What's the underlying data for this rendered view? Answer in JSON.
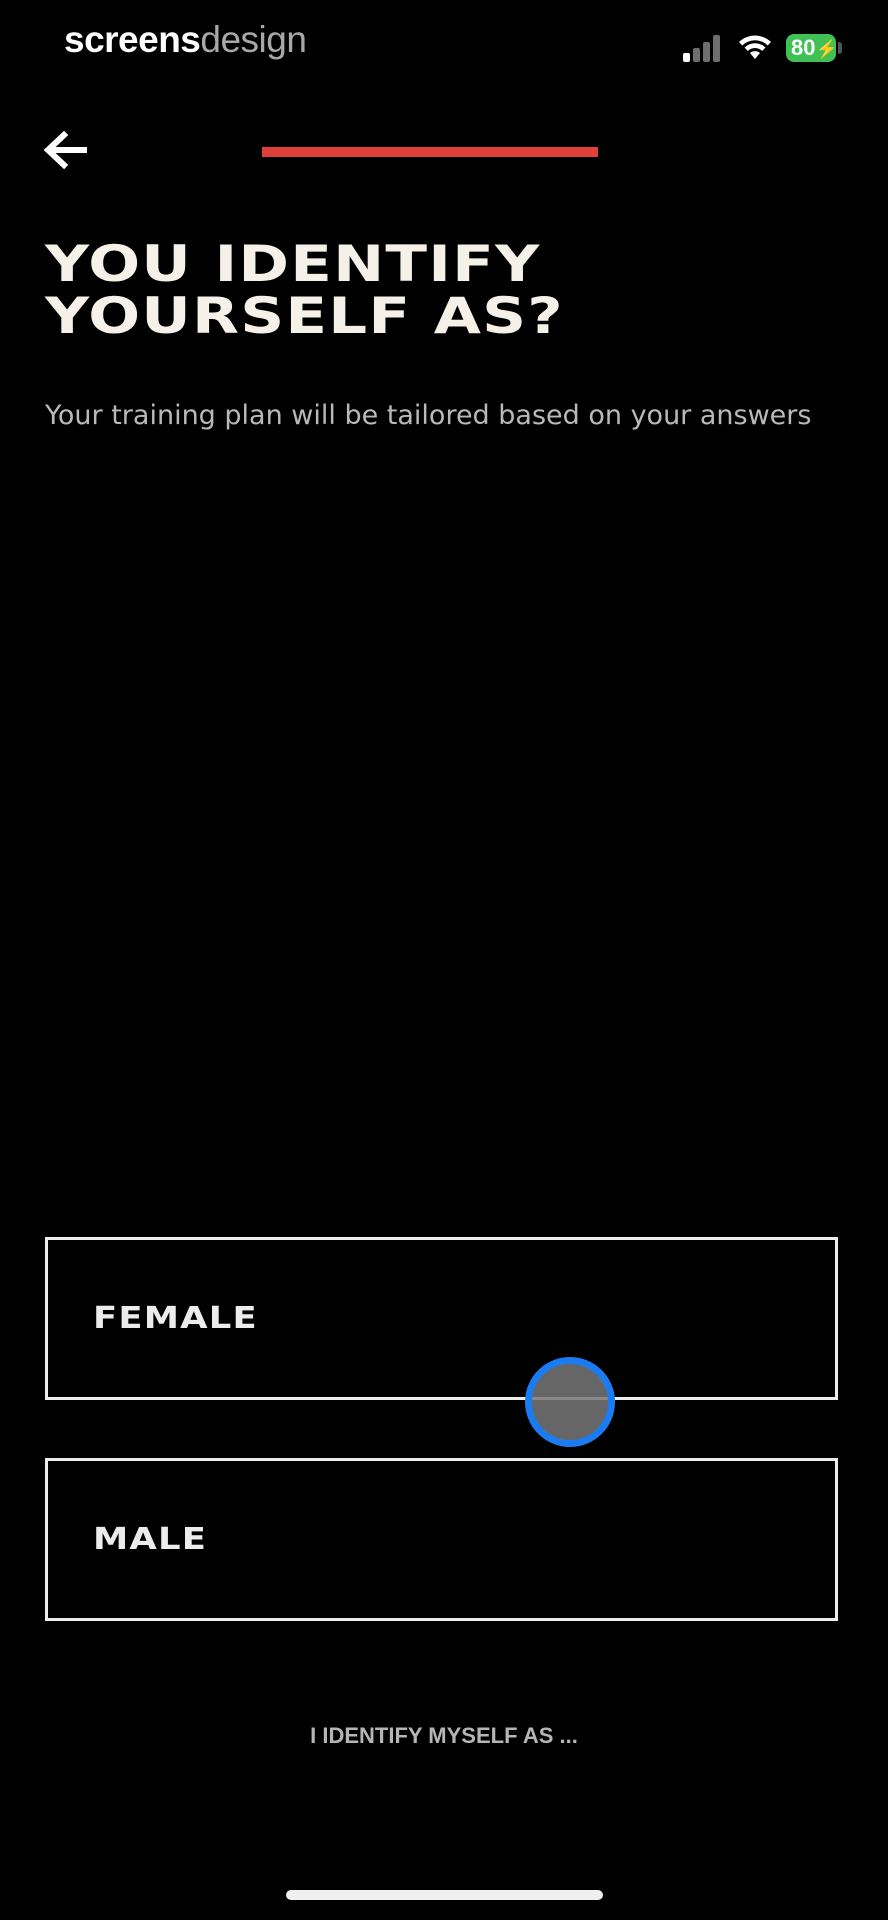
{
  "status_bar": {
    "brand_part1": "screens",
    "brand_part2": "design",
    "battery": "80",
    "icons": [
      "signal-icon",
      "wifi-icon",
      "battery-icon"
    ]
  },
  "header": {
    "back_icon": "arrow-left-icon",
    "progress": 1.0,
    "progress_color": "#e0403a"
  },
  "main": {
    "title_line1": "YOU IDENTIFY",
    "title_line2": "YOURSELF AS?",
    "subtitle": "Your training plan will be tailored based on your answers"
  },
  "options": [
    {
      "label": "FEMALE"
    },
    {
      "label": "MALE"
    }
  ],
  "footer": {
    "custom_link": "I IDENTIFY MYSELF AS ..."
  },
  "colors": {
    "background": "#000000",
    "accent": "#e0403a",
    "touch_ring": "#1a7cf0"
  }
}
